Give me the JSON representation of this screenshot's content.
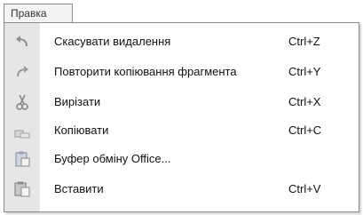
{
  "menubar": {
    "menu_title": "Правка"
  },
  "menu": {
    "items": [
      {
        "label": "Скасувати видалення",
        "shortcut": "Ctrl+Z",
        "icon": "undo-icon"
      },
      {
        "label": "Повторити копіювання фрагмента",
        "shortcut": "Ctrl+Y",
        "icon": "redo-icon"
      },
      {
        "label": "Вирізати",
        "shortcut": "Ctrl+X",
        "icon": "scissors-icon"
      },
      {
        "label": "Копіювати",
        "shortcut": "Ctrl+C",
        "icon": "copy-icon"
      },
      {
        "label": "Буфер обміну Office...",
        "shortcut": "",
        "icon": "clipboard-icon"
      },
      {
        "label": "Вставити",
        "shortcut": "Ctrl+V",
        "icon": "paste-icon"
      }
    ]
  },
  "colors": {
    "gutter": "#e6e6e6",
    "border": "#8a8a8a"
  }
}
